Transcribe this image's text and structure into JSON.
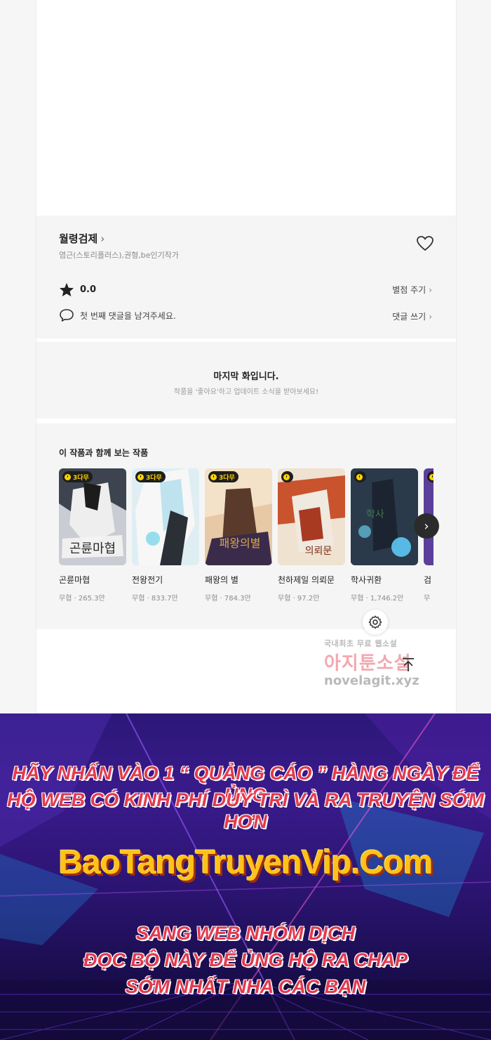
{
  "series": {
    "title": "월령검제",
    "authors": "염근(스토리플러스),권형,be인기작가",
    "rating": "0.0",
    "rate_link": "별점 주기",
    "comment_prompt": "첫 번째 댓글을 남겨주세요.",
    "comment_link": "댓글 쓰기"
  },
  "last_episode": {
    "title": "마지막 화입니다.",
    "subtitle": "작품을 '좋아요'하고 업데이트 소식을 받아보세요!"
  },
  "recommendations": {
    "heading": "이 작품과 함께 보는 작품",
    "items": [
      {
        "badge": "3다무",
        "name": "곤륜마협",
        "views": "무협 · 265.3만"
      },
      {
        "badge": "3다무",
        "name": "전왕전기",
        "views": "무협 · 833.7만"
      },
      {
        "badge": "3다무",
        "name": "패왕의 별",
        "views": "무협 · 784.3만"
      },
      {
        "badge": "",
        "name": "천하제일 의뢰문",
        "views": "무협 · 97.2만"
      },
      {
        "badge": "",
        "name": "학사귀환",
        "views": "무협 · 1,746.2만"
      },
      {
        "badge": "",
        "name": "검",
        "views": "무"
      }
    ]
  },
  "watermark": {
    "small": "국내최초 무료 웹소설",
    "big": "아지툰소설",
    "url": "novelagit.xyz"
  },
  "banner": {
    "line1": "HÃY NHẤN VÀO 1 “ QUẢNG CÁO ” HÀNG NGÀY ĐỂ ỦNG",
    "line2": "HỘ WEB CÓ KINH PHÍ DUY TRÌ VÀ RA TRUYỆN SỚM HƠN",
    "site": "BaoTangTruyenVip.Com",
    "line3": "SANG WEB NHÓM DỊCH",
    "line4": "ĐỌC BỘ NÀY  ĐỂ ỦNG HỘ RA CHAP",
    "line5": "SỚM NHẤT NHA CÁC BẠN"
  },
  "colors": {
    "badge_bg": "#1e1e1e",
    "badge_fg": "#ffd400",
    "banner_text": "#e23a4e",
    "banner_site": "#ffc21a"
  },
  "icons": [
    "chevron-right-icon",
    "heart-icon",
    "star-icon",
    "speech-bubble-icon",
    "clock-icon",
    "next-arrow-icon",
    "gear-icon",
    "arrow-up-icon"
  ]
}
